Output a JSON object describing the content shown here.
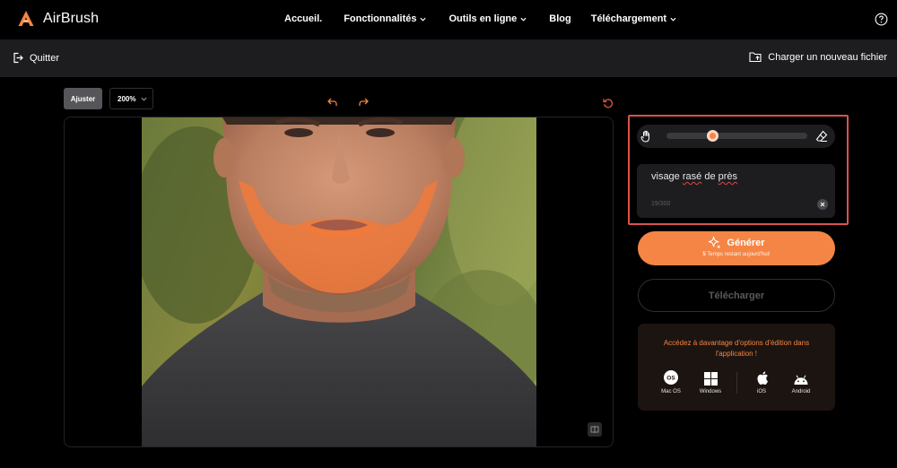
{
  "app": {
    "name": "AirBrush",
    "accent": "#f58544"
  },
  "nav": {
    "items": [
      {
        "label": "Accueil.",
        "dropdown": false
      },
      {
        "label": "Fonctionnalités",
        "dropdown": true
      },
      {
        "label": "Outils en ligne",
        "dropdown": true
      },
      {
        "label": "Blog",
        "dropdown": false
      },
      {
        "label": "Téléchargement",
        "dropdown": true
      }
    ],
    "help_icon": "help-circle-icon"
  },
  "subbar": {
    "quit_label": "Quitter",
    "upload_label": "Charger un nouveau fichier"
  },
  "editor": {
    "adjust_label": "Ajuster",
    "zoom_value": "200%"
  },
  "panel": {
    "brush_size_fraction": 0.33,
    "prompt_value": "visage rasé de près",
    "prompt_count": "19/300",
    "generate_label": "Générer",
    "generate_remaining_count": "5",
    "generate_remaining_text": "Temps restant aujourd'hui!",
    "download_label": "Télécharger",
    "promo_title": "Accédez à davantage d'options d'édition dans l'application !",
    "platforms": [
      {
        "label": "Mac OS",
        "icon": "macos-icon"
      },
      {
        "label": "Windows",
        "icon": "windows-icon"
      },
      {
        "label": "iOS",
        "icon": "apple-icon"
      },
      {
        "label": "Android",
        "icon": "android-icon"
      }
    ]
  }
}
